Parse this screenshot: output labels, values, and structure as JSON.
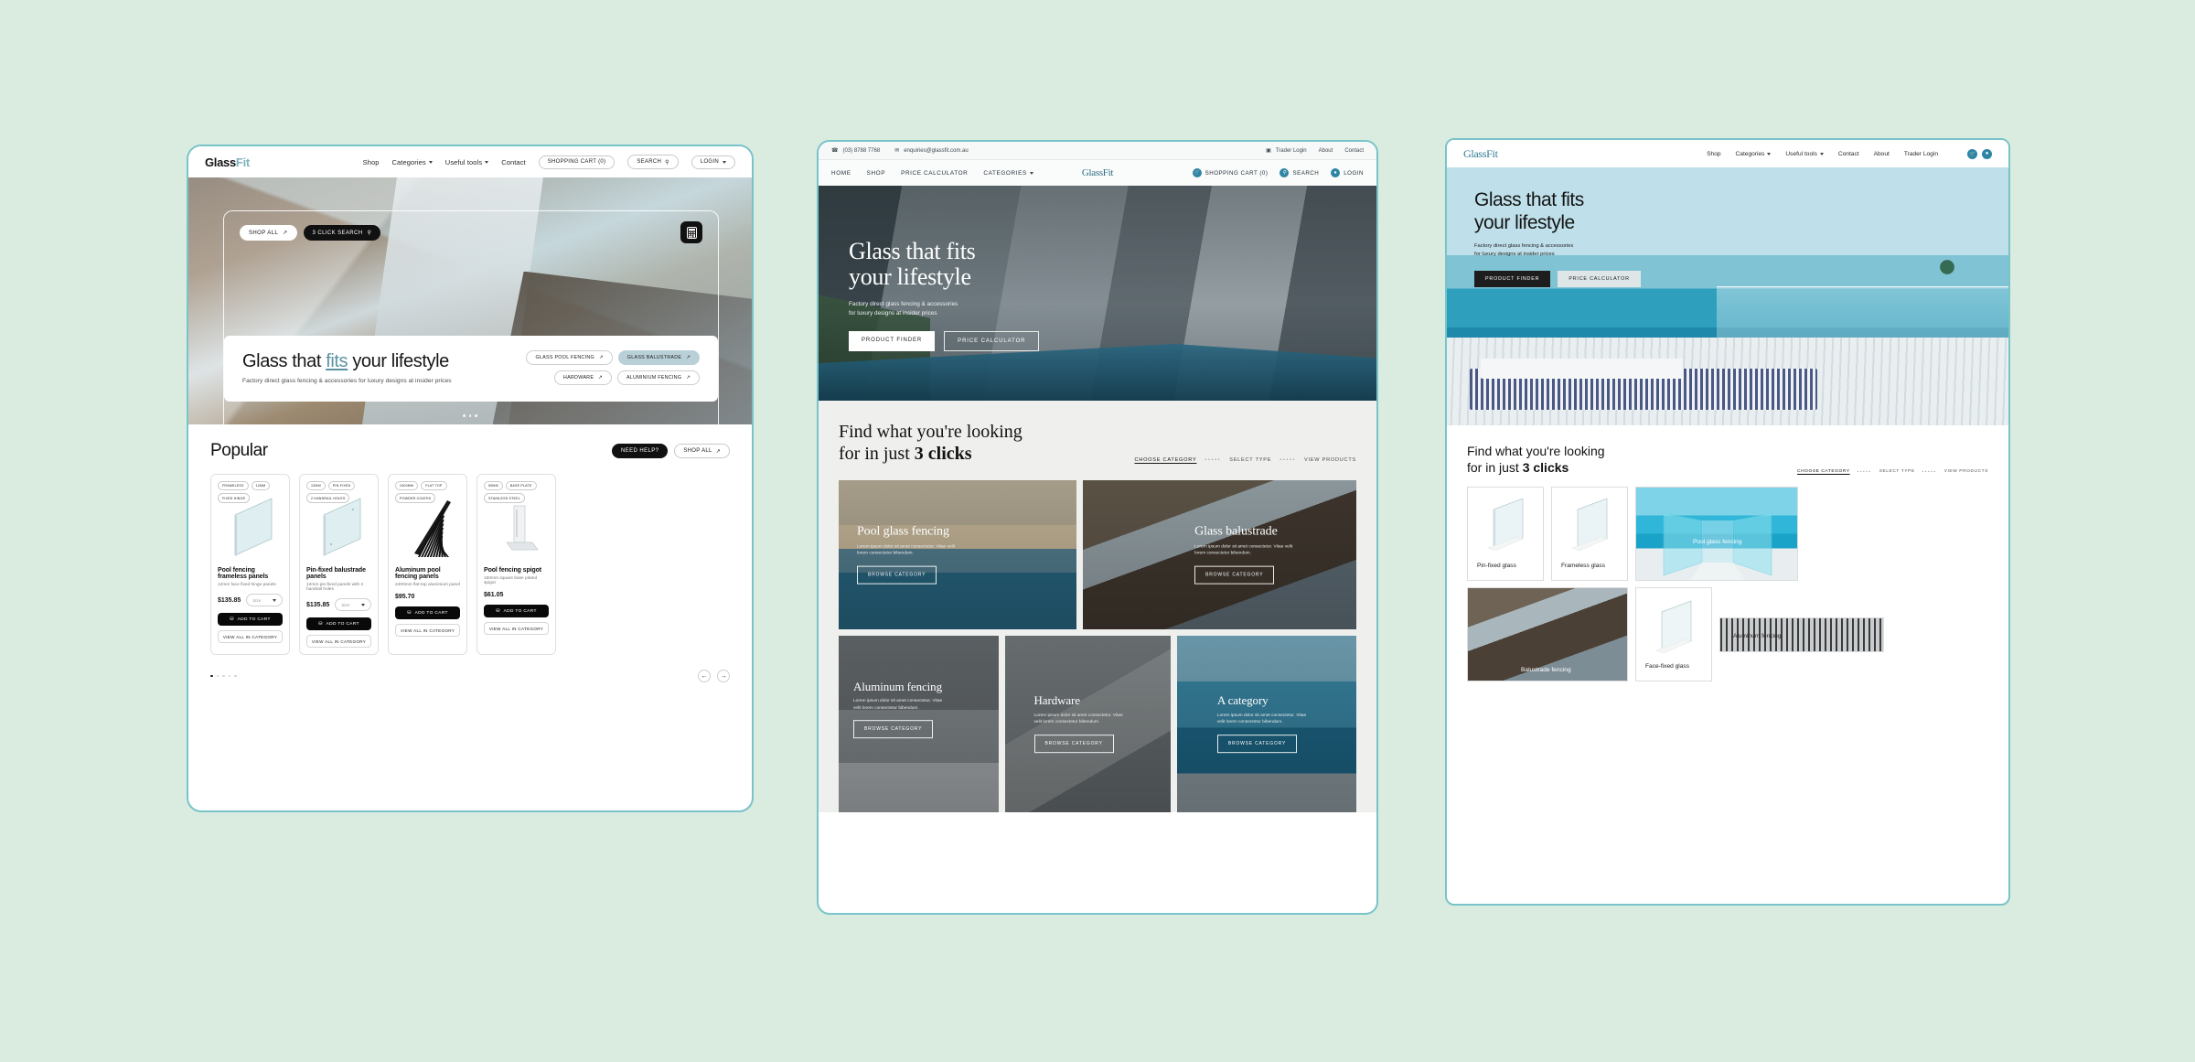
{
  "brand": {
    "name": "GlassFit",
    "name_part1": "Glass",
    "name_part2": "Fit"
  },
  "panel1": {
    "nav": {
      "links": [
        "Shop",
        "Categories",
        "Useful tools",
        "Contact"
      ],
      "cart": "SHOPPING CART (0)",
      "search": "SEARCH",
      "login": "LOGIN"
    },
    "hero": {
      "shop_all": "SHOP ALL",
      "click_search": "3 CLICK SEARCH",
      "calculator_icon": "calculator-icon",
      "title_part1": "Glass that ",
      "title_underlined": "fits",
      "title_part2": " your lifestyle",
      "subtitle": "Factory direct glass fencing & accessories for luxury designs at insider prices",
      "chips": [
        "GLASS POOL FENCING",
        "GLASS BALUSTRADE",
        "HARDWARE",
        "ALUMINIUM FENCING"
      ],
      "active_chip": "GLASS BALUSTRADE"
    },
    "popular": {
      "title": "Popular",
      "need_help": "NEED HELP?",
      "shop_all": "SHOP ALL",
      "add_to_cart": "ADD TO CART",
      "view_all": "VIEW ALL IN CATEGORY",
      "size_placeholder": "Size",
      "products": [
        {
          "tags": [
            "FRAMELESS",
            "12MM",
            "FIXED HINGE"
          ],
          "name": "Pool fencing frameless panels",
          "desc": "12mm face fixed hinge panels",
          "price": "$135.85",
          "has_select": true
        },
        {
          "tags": [
            "12MM",
            "PIN-FIXED",
            "2 HANDRAIL HOLES"
          ],
          "name": "Pin-fixed balustrade panels",
          "desc": "12mm pin-fixed panels with 2 handrail holes",
          "price": "$135.85",
          "has_select": true
        },
        {
          "tags": [
            "2400MM",
            "FLAT TOP",
            "POWDER COATED"
          ],
          "name": "Aluminum pool fencing panels",
          "desc": "2400mm flat-top aluminium panel",
          "price": "$95.70",
          "has_select": false
        },
        {
          "tags": [
            "50MM",
            "BASE PLATE",
            "STAINLESS STEEL"
          ],
          "name": "Pool fencing spigot",
          "desc": "150mm square base plated spigot",
          "price": "$61.05",
          "has_select": false
        }
      ],
      "dots": 5,
      "active_dot": 0,
      "prev_icon": "arrow-left-icon",
      "next_icon": "arrow-right-icon"
    }
  },
  "panel2": {
    "topbar": {
      "phone": "(03) 8788 7768",
      "email": "enquiries@glassfit.com.au",
      "trader_login": "Trader Login",
      "about": "About",
      "contact": "Contact"
    },
    "nav": {
      "links": [
        "HOME",
        "SHOP",
        "PRICE CALCULATOR",
        "CATEGORIES"
      ],
      "cart": "SHOPPING CART (0)",
      "search": "SEARCH",
      "login": "LOGIN"
    },
    "hero": {
      "title_line1": "Glass that fits",
      "title_line2": "your lifestyle",
      "sub_line1": "Factory direct glass fencing & accessories",
      "sub_line2": "for luxury designs at insider prices",
      "btn_primary": "PRODUCT FINDER",
      "btn_secondary": "PRICE CALCULATOR"
    },
    "find": {
      "title_line1": "Find what you're looking",
      "title_line2_pre": "for in just ",
      "title_line2_bold": "3 clicks",
      "steps": [
        "CHOOSE CATEGORY",
        "SELECT TYPE",
        "VIEW PRODUCTS"
      ],
      "active_step": "CHOOSE CATEGORY",
      "browse_label": "BROWSE CATEGORY",
      "lorem": "Lorem ipsum dolor sit amet consectetur. Vitae velit lorem consectetur bibendum.",
      "categories": [
        {
          "name": "Pool glass fencing"
        },
        {
          "name": "Glass balustrade"
        },
        {
          "name": "Aluminum fencing"
        },
        {
          "name": "Hardware"
        },
        {
          "name": "A category"
        }
      ]
    }
  },
  "panel3": {
    "nav": {
      "links": [
        "Shop",
        "Categories",
        "Useful tools",
        "Contact",
        "About",
        "Trader Login"
      ],
      "cart_icon": "cart-icon",
      "user_icon": "user-icon"
    },
    "hero": {
      "title_line1": "Glass that fits",
      "title_line2": "your lifestyle",
      "sub_line1": "Factory direct glass fencing & accessories",
      "sub_line2": "for luxury designs at insider prices",
      "btn_primary": "PRODUCT FINDER",
      "btn_secondary": "PRICE CALCULATOR"
    },
    "find": {
      "title_line1": "Find what you're looking",
      "title_line2_pre": "for in just ",
      "title_line2_bold": "3 clicks",
      "steps": [
        "CHOOSE CATEGORY",
        "SELECT TYPE",
        "VIEW PRODUCTS"
      ],
      "active_step": "CHOOSE CATEGORY",
      "tiles": [
        {
          "name": "Pin-fixed glass"
        },
        {
          "name": "Frameless glass"
        },
        {
          "name": "Pool glass fencing"
        },
        {
          "name": "Balustrade fencing"
        },
        {
          "name": "Face-fixed glass"
        },
        {
          "name": "Aluminum fencing"
        }
      ]
    }
  },
  "colors": {
    "background": "#d9ecdf",
    "panel_border": "#79c3c9",
    "accent_teal": "#2e85a3",
    "link_blue": "#5b93a3",
    "dark": "#111111"
  }
}
